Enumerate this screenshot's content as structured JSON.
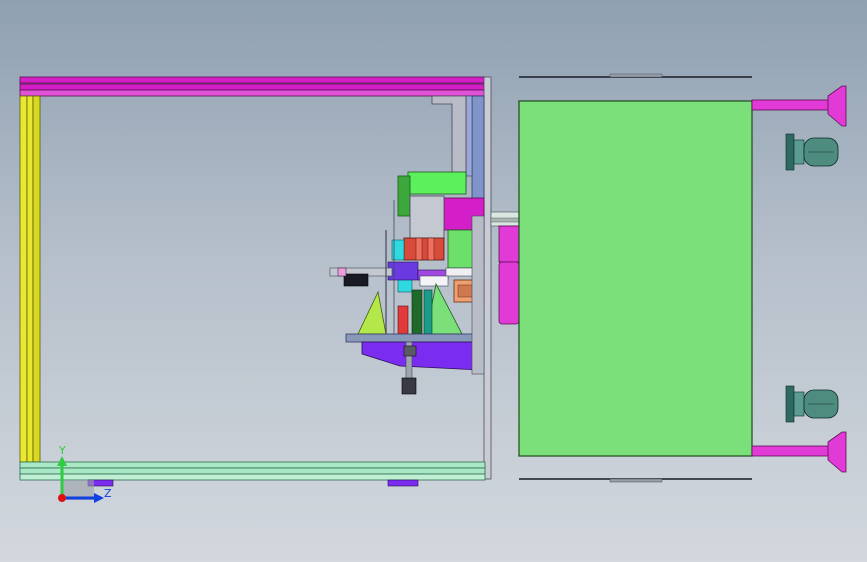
{
  "viewport": {
    "background_top": "#8fa0b2",
    "background_bottom": "#d3d8de"
  },
  "triad": {
    "y_label": "Y",
    "z_label": "Z",
    "y_color": "#2ecc40",
    "z_color": "#1040e0",
    "origin_color": "#e01010"
  },
  "colors": {
    "frame_magenta": "#d41ec8",
    "rail_yellow": "#e8e830",
    "rail_mint": "#a8e8c4",
    "panel_green": "#7ce07a",
    "steel_blue": "#7f94c8",
    "violet": "#7a2cf0",
    "cylinder_pink": "#e23ad6",
    "wheel_teal": "#4f8c80"
  },
  "icons": [
    "coordinate-triad-icon",
    "caster-wheel-icon",
    "leveling-foot-icon"
  ]
}
